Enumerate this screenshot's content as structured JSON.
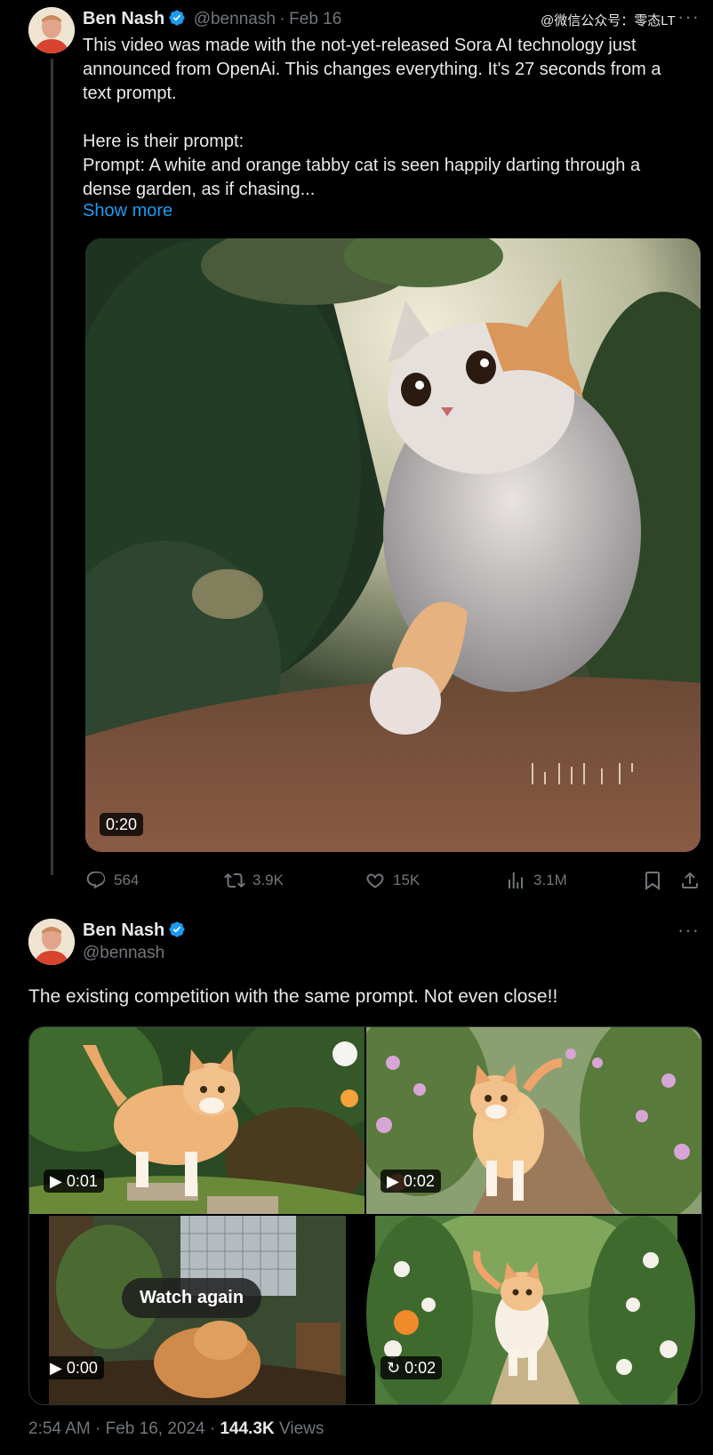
{
  "watermark": "@微信公众号：零态LT",
  "tweet1": {
    "name": "Ben Nash",
    "handle": "@bennash",
    "sep": "·",
    "date": "Feb 16",
    "text": "This video was made with the not-yet-released Sora AI technology just announced from OpenAi. This changes everything. It's 27 seconds from a text prompt.\n\nHere is their prompt:\nPrompt: A white and orange tabby cat is seen happily darting through a dense garden, as if chasing...",
    "show_more": "Show more",
    "video_duration": "0:20",
    "replies": "564",
    "retweets": "3.9K",
    "likes": "15K",
    "views": "3.1M"
  },
  "tweet2": {
    "name": "Ben Nash",
    "handle": "@bennash",
    "text": "The existing competition with the same prompt. Not even close!!",
    "videos": [
      {
        "duration": "0:01",
        "icon": "play-icon"
      },
      {
        "duration": "0:02",
        "icon": "play-icon"
      },
      {
        "duration": "0:00",
        "icon": "play-icon",
        "overlay": "Watch again"
      },
      {
        "duration": "0:02",
        "icon": "replay-icon"
      }
    ],
    "time": "2:54 AM",
    "date": "Feb 16, 2024",
    "views_count": "144.3K",
    "views_label": "Views"
  },
  "colors": {
    "accent": "#1d9bf0",
    "muted": "#71767b",
    "text": "#e7e9ea",
    "background": "#000000"
  }
}
